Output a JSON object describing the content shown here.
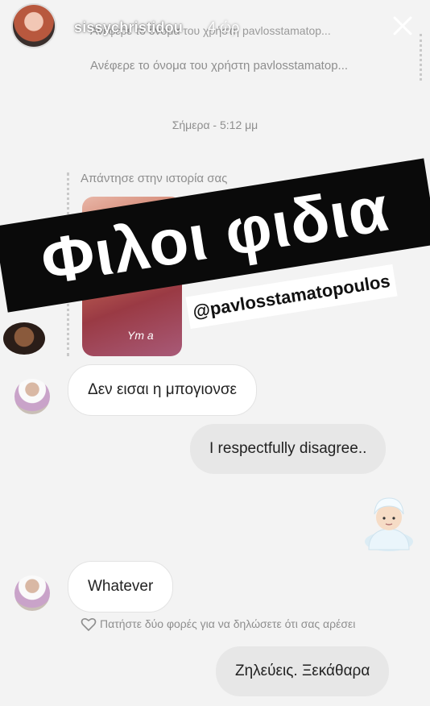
{
  "story": {
    "username": "sissychristidou",
    "time_ago": "4 ώρ"
  },
  "thread": {
    "mention_header_faded": "Ανέφερε το όνομα του χρήστη pavlosstamatop...",
    "mention_text": "Ανέφερε το όνομα του χρήστη pavlosstamatop...",
    "date_separator": "Σήμερα - 5:12 μμ",
    "reply_note": "Απάντησε στην ιστορία σας",
    "story_thumb_text": "Ym a",
    "messages": [
      {
        "text": "Δεν εισαι η μπογιονσε",
        "sender": "incoming"
      },
      {
        "text": "I respectfully disagree..",
        "sender": "outgoing"
      },
      {
        "text": "Whatever",
        "sender": "incoming"
      },
      {
        "text": "Ζηλεύεις. Ξεκάθαρα",
        "sender": "outgoing"
      }
    ],
    "like_hint": "Πατήστε δύο φορές για να δηλώσετε ότι σας αρέσει"
  },
  "overlay": {
    "banner_text": "Φιλοι φιδια",
    "mention_handle": "@pavlosstamatopoulos",
    "banner_color": "#0a0a0a"
  },
  "icons": {
    "close": "close-icon",
    "heart": "heart-icon",
    "sticker": "person-in-towel-emoji"
  }
}
